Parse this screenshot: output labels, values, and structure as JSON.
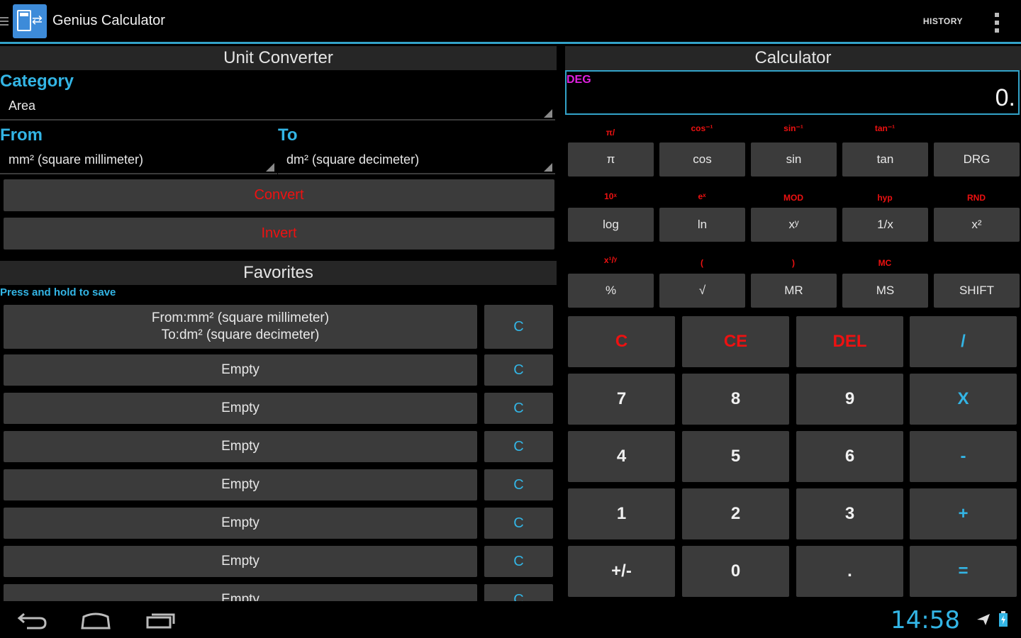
{
  "app": {
    "title": "Genius Calculator",
    "history_label": "HISTORY"
  },
  "converter": {
    "header": "Unit Converter",
    "category_label": "Category",
    "category_value": "Area",
    "from_label": "From",
    "to_label": "To",
    "from_value": "mm² (square millimeter)",
    "to_value": "dm² (square decimeter)",
    "convert_label": "Convert",
    "invert_label": "Invert"
  },
  "favorites": {
    "header": "Favorites",
    "hint": "Press and hold to save",
    "items": [
      {
        "line1": "From:mm² (square millimeter)",
        "line2": "To:dm² (square decimeter)",
        "clear": "C"
      },
      {
        "line1": "Empty",
        "line2": "",
        "clear": "C"
      },
      {
        "line1": "Empty",
        "line2": "",
        "clear": "C"
      },
      {
        "line1": "Empty",
        "line2": "",
        "clear": "C"
      },
      {
        "line1": "Empty",
        "line2": "",
        "clear": "C"
      },
      {
        "line1": "Empty",
        "line2": "",
        "clear": "C"
      },
      {
        "line1": "Empty",
        "line2": "",
        "clear": "C"
      },
      {
        "line1": "Empty",
        "line2": "",
        "clear": "C"
      }
    ]
  },
  "calculator": {
    "header": "Calculator",
    "angle_mode": "DEG",
    "display": "0.",
    "sci_rows": [
      {
        "shift": [
          "π/",
          "cos⁻¹",
          "sin⁻¹",
          "tan⁻¹",
          ""
        ],
        "keys": [
          "π",
          "cos",
          "sin",
          "tan",
          "DRG"
        ]
      },
      {
        "shift": [
          "10ˣ",
          "eˣ",
          "MOD",
          "hyp",
          "RND"
        ],
        "keys": [
          "log",
          "ln",
          "xʸ",
          "1/x",
          "x²"
        ]
      },
      {
        "shift": [
          "x¹/ʸ",
          "(",
          ")",
          "MC",
          ""
        ],
        "keys": [
          "%",
          "√",
          "MR",
          "MS",
          "SHIFT"
        ]
      }
    ],
    "main_keys": [
      [
        "C",
        "CE",
        "DEL",
        "/"
      ],
      [
        "7",
        "8",
        "9",
        "X"
      ],
      [
        "4",
        "5",
        "6",
        "-"
      ],
      [
        "1",
        "2",
        "3",
        "+"
      ],
      [
        "+/-",
        "0",
        ".",
        "="
      ]
    ],
    "colors": {
      "red": "#ee1111",
      "blue": "#33b5e5"
    }
  },
  "status": {
    "time": "14:58"
  }
}
